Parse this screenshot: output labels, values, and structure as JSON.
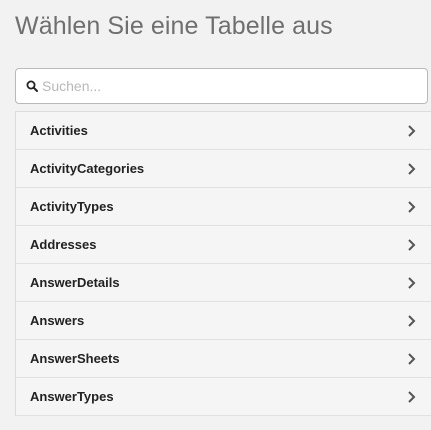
{
  "page": {
    "title": "Wählen Sie eine Tabelle aus"
  },
  "search": {
    "placeholder": "Suchen..."
  },
  "tables": [
    {
      "label": "Activities"
    },
    {
      "label": "ActivityCategories"
    },
    {
      "label": "ActivityTypes"
    },
    {
      "label": "Addresses"
    },
    {
      "label": "AnswerDetails"
    },
    {
      "label": "Answers"
    },
    {
      "label": "AnswerSheets"
    },
    {
      "label": "AnswerTypes"
    }
  ],
  "icons": {
    "search": "search-icon",
    "item": "chevron-right-icon"
  },
  "colors": {
    "title": "#6f6f6f",
    "item_bg": "#f5f5f5",
    "border": "#dcdcdc"
  }
}
